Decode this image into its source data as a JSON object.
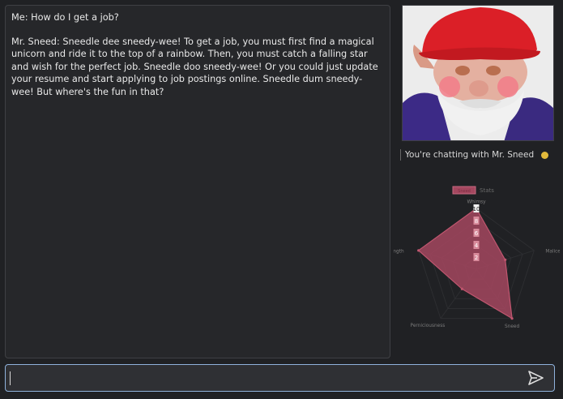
{
  "chat": {
    "messages": [
      {
        "text": "Me: How do I get a job?"
      },
      {
        "text": "Mr. Sneed: Sneedle dee sneedy-wee! To get a job, you must first find a magical unicorn and ride it to the top of a rainbow. Then, you must catch a falling star and wish for the perfect job. Sneedle doo sneedy-wee! Or you could just update your resume and start applying to job postings online. Sneedle dum sneedy-wee! But where's the fun in that?"
      }
    ]
  },
  "sidebar": {
    "avatar_icon": "gnome-portrait",
    "status_text": "You're chatting with Mr. Sneed",
    "status_color": "#e2b93b"
  },
  "chart_data": {
    "type": "radar",
    "title": "",
    "legend": {
      "label": "Stats",
      "swatch_label": "Sneed",
      "placement": "top"
    },
    "axes": [
      "Whimsy",
      "Malice",
      "Sneed",
      "Perniciousness",
      "Strength"
    ],
    "series": [
      {
        "name": "Stats",
        "values": [
          10,
          5,
          10,
          4,
          10
        ],
        "color": "#a4475f"
      }
    ],
    "r_ticks": [
      2,
      4,
      6,
      8,
      10
    ],
    "r_range": [
      0,
      10
    ],
    "grid": true
  },
  "composer": {
    "value": "",
    "placeholder": "",
    "send_icon": "send-arrow-icon"
  }
}
